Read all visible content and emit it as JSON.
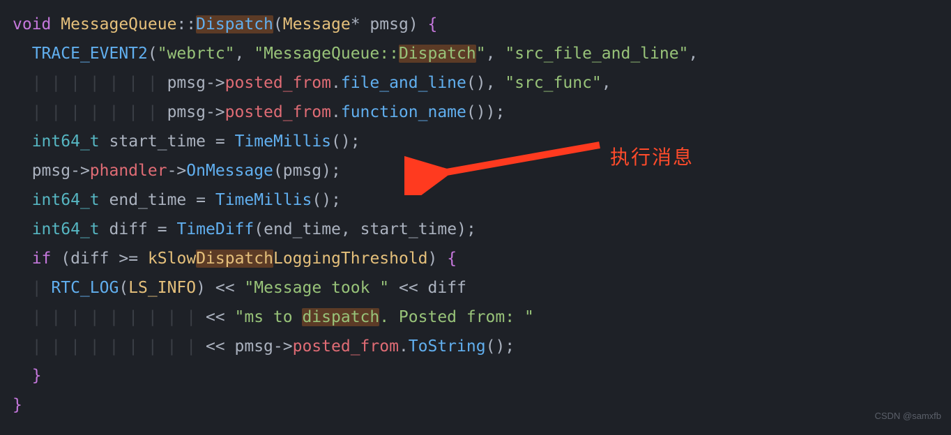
{
  "code": {
    "l1": {
      "kw": "void",
      "cls": "MessageQueue",
      "sep": "::",
      "fn": "Dispatch",
      "lp": "(",
      "ty": "Message",
      "star": "*",
      "arg": "pmsg",
      "rp": ")",
      "ob": "{"
    },
    "l2": {
      "macro": "TRACE_EVENT2",
      "lp": "(",
      "s1": "\"webrtc\"",
      "c1": ",",
      "s2a": "\"MessageQueue::",
      "s2b": "Dispatch",
      "s2c": "\"",
      "c2": ",",
      "s3": "\"src_file_and_line\"",
      "c3": ","
    },
    "l3": {
      "v": "pmsg",
      "arrow": "->",
      "m": "posted_from",
      "dot": ".",
      "fn": "file_and_line",
      "lp": "(",
      "rp": ")",
      "c": ",",
      "s": "\"src_func\"",
      "c2": ","
    },
    "l4": {
      "v": "pmsg",
      "arrow": "->",
      "m": "posted_from",
      "dot": ".",
      "fn": "function_name",
      "lp": "(",
      "rp": ")",
      "rp2": ")",
      "sc": ";"
    },
    "l5": {
      "ty": "int64_t",
      "v": "start_time",
      "eq": "=",
      "fn": "TimeMillis",
      "lp": "(",
      "rp": ")",
      "sc": ";"
    },
    "l6": {
      "v": "pmsg",
      "a1": "->",
      "m": "phandler",
      "a2": "->",
      "fn": "OnMessage",
      "lp": "(",
      "arg": "pmsg",
      "rp": ")",
      "sc": ";"
    },
    "l7": {
      "ty": "int64_t",
      "v": "end_time",
      "eq": "=",
      "fn": "TimeMillis",
      "lp": "(",
      "rp": ")",
      "sc": ";"
    },
    "l8": {
      "ty": "int64_t",
      "v": "diff",
      "eq": "=",
      "fn": "TimeDiff",
      "lp": "(",
      "a1": "end_time",
      "c": ",",
      "a2": "start_time",
      "rp": ")",
      "sc": ";"
    },
    "l9": {
      "kw": "if",
      "lp": "(",
      "v": "diff",
      "op": ">=",
      "ca": "kSlow",
      "cb": "Dispatch",
      "cc": "LoggingThreshold",
      "rp": ")",
      "ob": "{"
    },
    "l10": {
      "macro": "RTC_LOG",
      "lp": "(",
      "arg": "LS_INFO",
      "rp": ")",
      "op": "<<",
      "s": "\"Message took \"",
      "op2": "<<",
      "v": "diff"
    },
    "l11": {
      "op": "<<",
      "s1": "\"ms to ",
      "s2": "dispatch",
      "s3": ". Posted from: \""
    },
    "l12": {
      "op": "<<",
      "v": "pmsg",
      "arrow": "->",
      "m": "posted_from",
      "dot": ".",
      "fn": "ToString",
      "lp": "(",
      "rp": ")",
      "sc": ";"
    },
    "l13": {
      "cb": "}"
    },
    "l14": {
      "cb": "}"
    }
  },
  "annotation": "执行消息",
  "watermark": "CSDN @samxfb"
}
